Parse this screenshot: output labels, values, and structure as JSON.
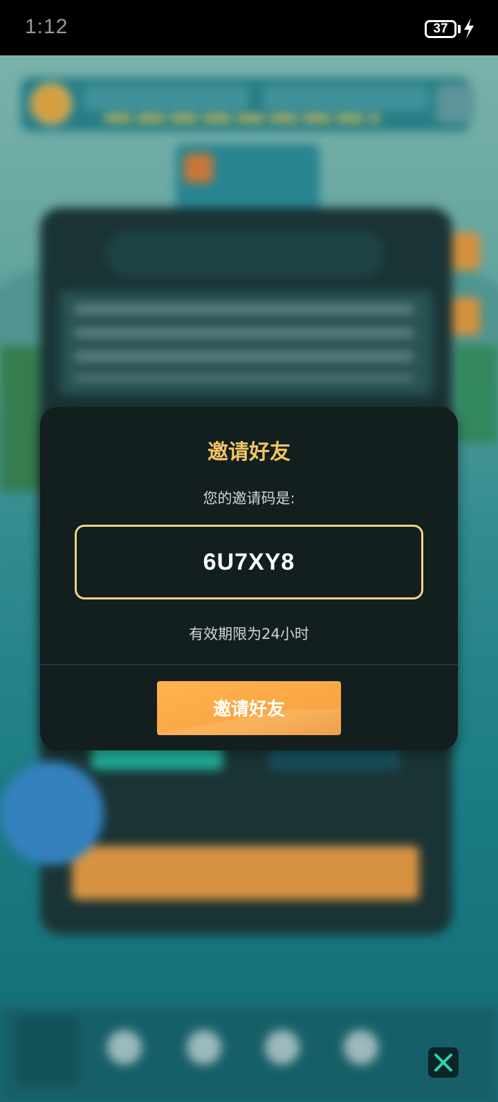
{
  "status_bar": {
    "time": "1:12",
    "battery_level": "37",
    "charging_icon": "lightning-bolt-icon"
  },
  "invite_dialog": {
    "title": "邀请好友",
    "code_prompt": "您的邀请码是:",
    "invite_code": "6U7XY8",
    "validity_note": "有效期限为24小时",
    "invite_button_label": "邀请好友"
  },
  "colors": {
    "title_gold": "#f3c562",
    "code_border": "#f1d583",
    "button_orange": "#f8a542",
    "modal_bg": "#131e1f"
  }
}
